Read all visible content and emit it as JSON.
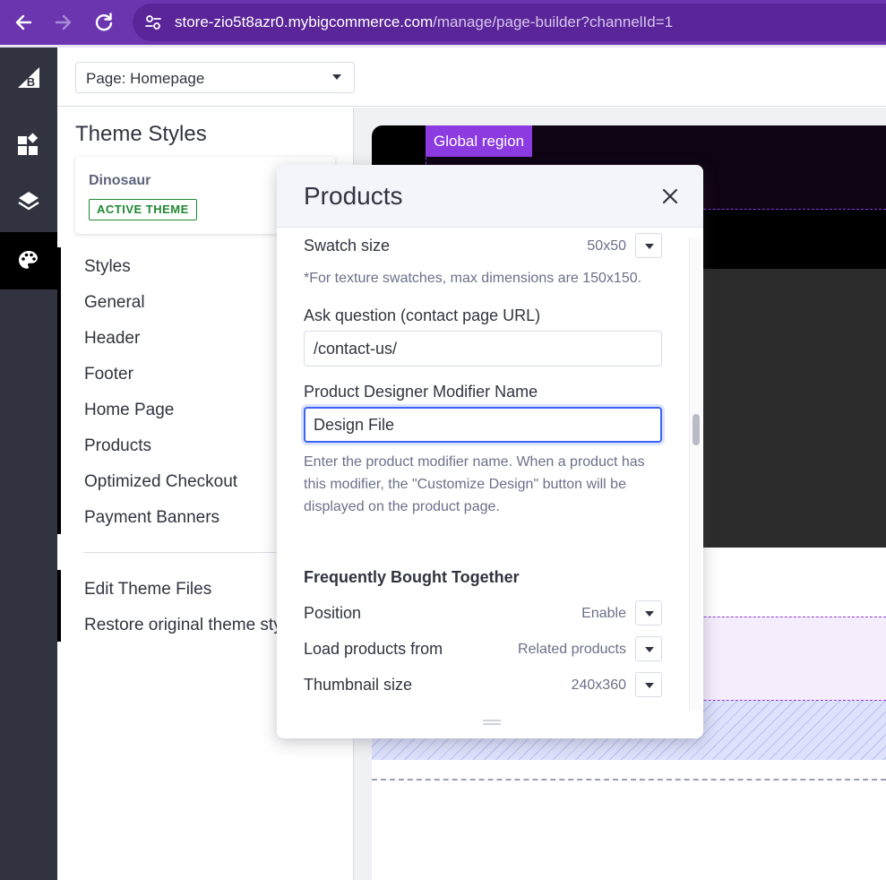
{
  "browser": {
    "url_host": "store-zio5t8azr0.mybigcommerce.com",
    "url_path": "/manage/page-builder?channelId=1",
    "back_icon": "arrow-left-icon",
    "forward_icon": "arrow-right-icon",
    "reload_icon": "reload-icon",
    "site_info_icon": "tune-icon"
  },
  "rail": {
    "items": [
      "bigcommerce-logo-icon",
      "widgets-icon",
      "layers-icon",
      "palette-icon"
    ],
    "active": "palette-icon"
  },
  "page_select": {
    "label": "Page: Homepage"
  },
  "sidebar": {
    "title": "Theme Styles",
    "theme_name": "Dinosaur",
    "theme_badge": "ACTIVE THEME",
    "menu": [
      "Styles",
      "General",
      "Header",
      "Footer",
      "Home Page",
      "Products",
      "Optimized Checkout",
      "Payment Banners"
    ],
    "secondary": [
      "Edit Theme Files",
      "Restore original theme sty"
    ]
  },
  "preview": {
    "global_region_label": "Global region"
  },
  "modal": {
    "title": "Products",
    "swatch_label": "Swatch size",
    "swatch_value": "50x50",
    "swatch_help": "*For texture swatches, max dimensions are 150x150.",
    "ask_label": "Ask question (contact page URL)",
    "ask_value": "/contact-us/",
    "designer_label": "Product Designer Modifier Name",
    "designer_value": "Design File",
    "designer_help": "Enter the product modifier name. When a product has this modifier, the \"Customize Design\" button will be displayed on the product page.",
    "fbt_title": "Frequently Bought Together",
    "rows": [
      {
        "label": "Position",
        "value": "Enable"
      },
      {
        "label": "Load products from",
        "value": "Related products"
      },
      {
        "label": "Thumbnail size",
        "value": "240x360"
      }
    ]
  },
  "colors": {
    "browser_bar": "#6b35b0",
    "rail": "#313440",
    "global_region": "#8c3be0",
    "active_badge": "#208831",
    "focus_ring": "#3c64f4"
  }
}
